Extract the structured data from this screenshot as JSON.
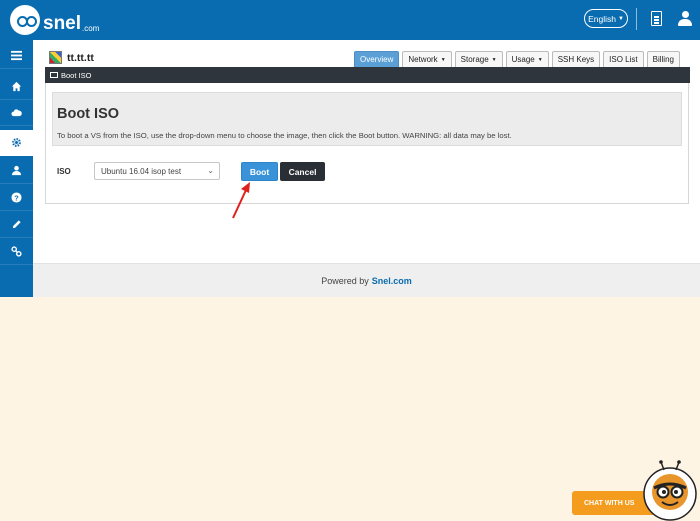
{
  "header": {
    "logo_text": "snel",
    "logo_suffix": ".com",
    "language": "English",
    "icons": [
      "document-icon",
      "user-icon"
    ]
  },
  "sidebar": {
    "items": [
      {
        "icon": "menu-icon"
      },
      {
        "icon": "home-icon"
      },
      {
        "icon": "cloud-icon"
      },
      {
        "icon": "gear-icon",
        "active": true
      },
      {
        "icon": "user-icon"
      },
      {
        "icon": "help-icon"
      },
      {
        "icon": "pencil-icon"
      },
      {
        "icon": "link-icon"
      }
    ]
  },
  "vs": {
    "name": "tt.tt.tt"
  },
  "tabs": [
    {
      "label": "Overview",
      "active": true,
      "dropdown": false
    },
    {
      "label": "Network",
      "active": false,
      "dropdown": true
    },
    {
      "label": "Storage",
      "active": false,
      "dropdown": true
    },
    {
      "label": "Usage",
      "active": false,
      "dropdown": true
    },
    {
      "label": "SSH Keys",
      "active": false,
      "dropdown": false
    },
    {
      "label": "ISO List",
      "active": false,
      "dropdown": false
    },
    {
      "label": "Billing",
      "active": false,
      "dropdown": false
    }
  ],
  "section_bar": {
    "label": "Boot ISO"
  },
  "boot_iso": {
    "title": "Boot ISO",
    "description": "To boot a VS from the ISO, use the drop-down menu to choose the image, then click the Boot button. WARNING: all data may be lost.",
    "iso_label": "ISO",
    "selected_iso": "Ubuntu 16.04 isop test",
    "boot_label": "Boot",
    "cancel_label": "Cancel"
  },
  "footer": {
    "text": "Powered by",
    "link": "Snel.com"
  },
  "chat": {
    "label": "CHAT WITH US"
  },
  "colors": {
    "brand_blue": "#0a6cb0",
    "boot_blue": "#3a93d8",
    "dark_bar": "#2f353c",
    "chat_orange": "#f39c1d",
    "page_bg": "#fdf4e3",
    "arrow_red": "#e0201b"
  }
}
